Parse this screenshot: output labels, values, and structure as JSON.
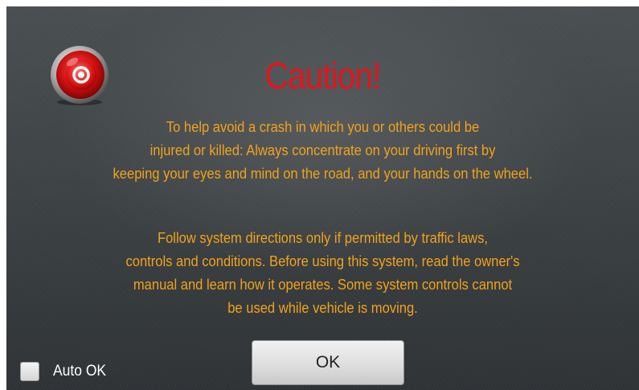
{
  "dialog": {
    "title": "Caution!",
    "icon": "red-alert-light-icon",
    "paragraph1": {
      "lines": [
        "To help avoid a crash in which you or others could be",
        "injured or killed: Always concentrate on your driving first by",
        "keeping your eyes and mind on the road, and your hands on the wheel."
      ]
    },
    "paragraph2": {
      "lines": [
        "Follow system directions only if permitted by traffic laws,",
        "controls and conditions. Before using this system, read the owner's",
        "manual and learn how it operates. Some system controls cannot",
        "be used while vehicle is moving."
      ]
    },
    "auto_ok": {
      "label": "Auto OK",
      "checked": false
    },
    "ok_label": "OK"
  },
  "colors": {
    "title": "#e3141c",
    "body_text": "#f2a21a",
    "background": "#3c4144",
    "button": "#dcdcdc"
  }
}
